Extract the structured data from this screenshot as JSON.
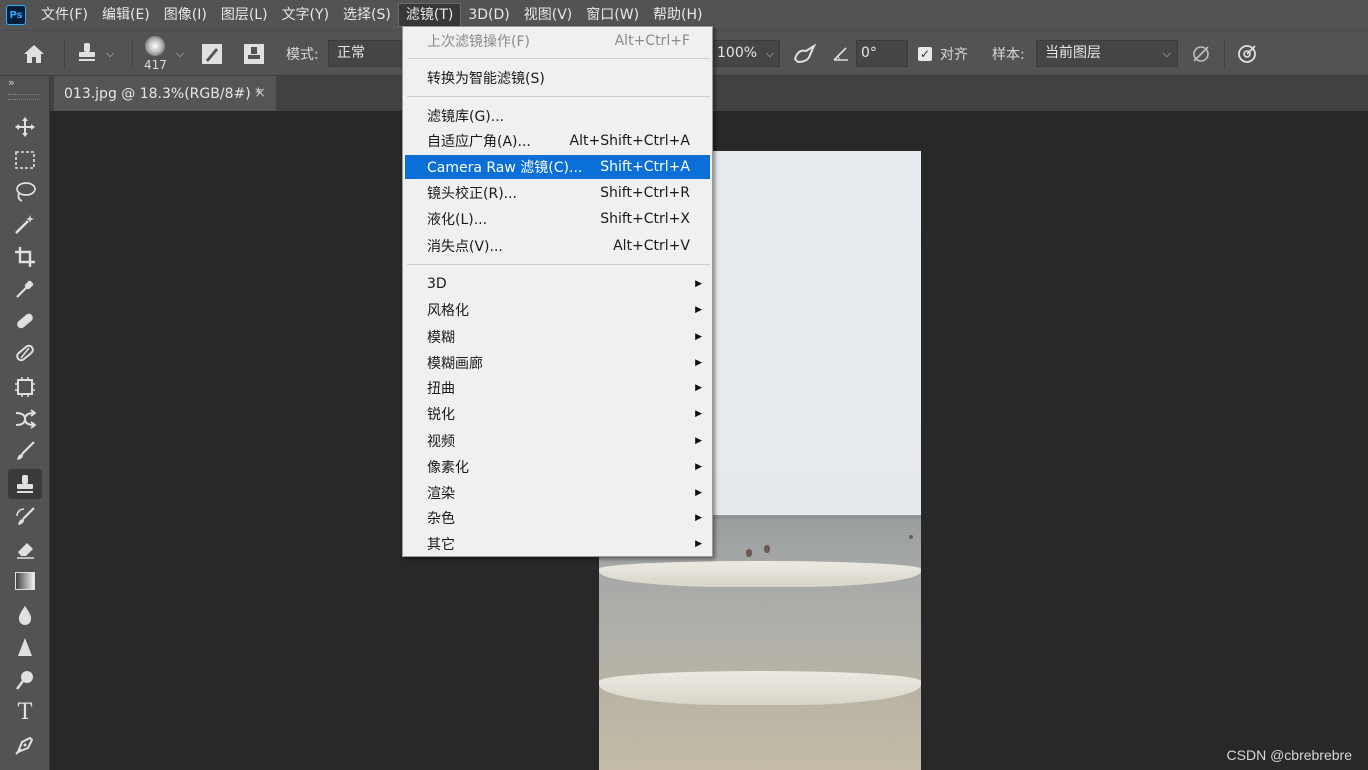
{
  "app": {
    "logo_text": "Ps"
  },
  "menubar": {
    "items": [
      "文件(F)",
      "编辑(E)",
      "图像(I)",
      "图层(L)",
      "文字(Y)",
      "选择(S)",
      "滤镜(T)",
      "3D(D)",
      "视图(V)",
      "窗口(W)",
      "帮助(H)"
    ],
    "active": "滤镜(T)"
  },
  "options_bar": {
    "brush_size": "417",
    "mode_label": "模式:",
    "mode_value": "正常",
    "flow_value": "100%",
    "angle_value": "0°",
    "align_label": "对齐",
    "align_checked": true,
    "sample_label": "样本:",
    "sample_value": "当前图层"
  },
  "document_tab": {
    "title": "013.jpg @ 18.3%(RGB/8#) *",
    "close": "×"
  },
  "filter_menu": {
    "last_filter": {
      "label": "上次滤镜操作(F)",
      "shortcut": "Alt+Ctrl+F"
    },
    "convert_smart": {
      "label": "转换为智能滤镜(S)"
    },
    "gallery": {
      "label": "滤镜库(G)..."
    },
    "adaptive_wide": {
      "label": "自适应广角(A)...",
      "shortcut": "Alt+Shift+Ctrl+A"
    },
    "camera_raw": {
      "label": "Camera Raw 滤镜(C)...",
      "shortcut": "Shift+Ctrl+A"
    },
    "lens_correction": {
      "label": "镜头校正(R)...",
      "shortcut": "Shift+Ctrl+R"
    },
    "liquify": {
      "label": "液化(L)...",
      "shortcut": "Shift+Ctrl+X"
    },
    "vanishing_point": {
      "label": "消失点(V)...",
      "shortcut": "Alt+Ctrl+V"
    },
    "submenus": [
      "3D",
      "风格化",
      "模糊",
      "模糊画廊",
      "扭曲",
      "锐化",
      "视频",
      "像素化",
      "渲染",
      "杂色",
      "其它"
    ],
    "highlighted": "Camera Raw 滤镜(C)..."
  },
  "toolbar": {
    "tools": [
      "move-tool",
      "marquee-tool",
      "lasso-tool",
      "magic-wand-tool",
      "crop-tool",
      "eyedropper-tool",
      "healing-brush-tool",
      "bandage-tool",
      "frame-tool",
      "content-aware-move-tool",
      "brush-tool",
      "clone-stamp-tool",
      "history-brush-tool",
      "eraser-tool",
      "gradient-tool",
      "blur-tool",
      "sharpen-tool",
      "dodge-tool",
      "type-tool",
      "pen-tool"
    ],
    "selected": "clone-stamp-tool"
  },
  "watermark": "CSDN @cbrebrebre",
  "colors": {
    "highlight": "#0a6fd6",
    "panel": "#535353",
    "canvas": "#282828"
  }
}
